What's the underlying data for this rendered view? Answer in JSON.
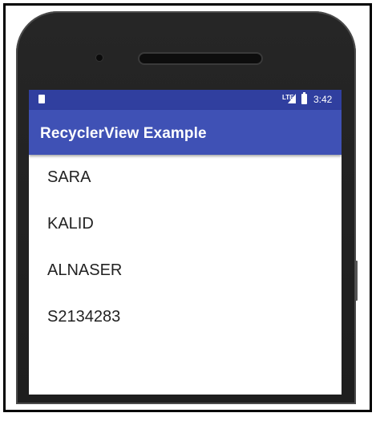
{
  "status_bar": {
    "network": "LTE",
    "time": "3:42"
  },
  "app_bar": {
    "title": "RecyclerView Example"
  },
  "list": {
    "items": [
      "SARA",
      "KALID",
      "ALNASER",
      "S2134283"
    ]
  },
  "colors": {
    "status_bar": "#303f9f",
    "app_bar": "#3f51b5"
  }
}
